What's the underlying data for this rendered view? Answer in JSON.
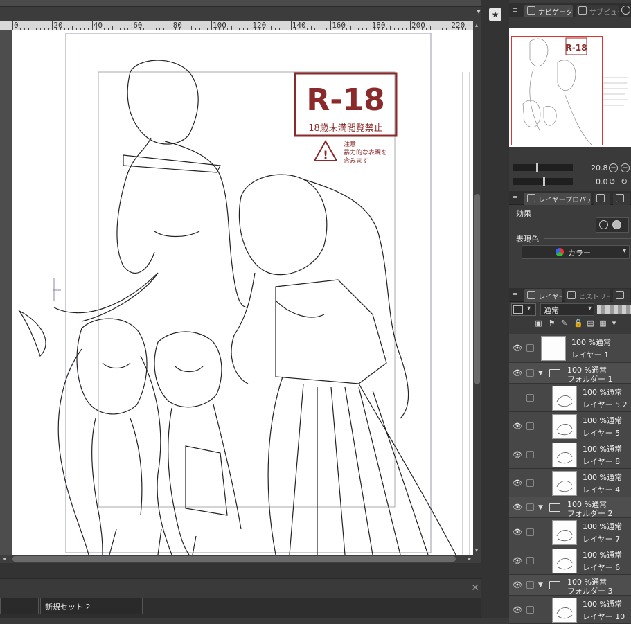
{
  "ruler": {
    "labels": [
      "0",
      "20",
      "40",
      "60",
      "80",
      "100",
      "120",
      "140",
      "160",
      "180",
      "200",
      "220"
    ]
  },
  "navigator": {
    "panel_menu": "≡",
    "tab_navigator": "ナビゲーター",
    "tab_subview": "サブビュー",
    "zoom_value": "20.8",
    "rotate_value": "0.0"
  },
  "layer_property": {
    "panel_menu": "≡",
    "tab_label": "レイヤープロパティ",
    "effect_label": "効果",
    "expression_label": "表現色",
    "expression_value": "カラー"
  },
  "layer_panel": {
    "panel_menu": "≡",
    "tab_layer": "レイヤー",
    "tab_history": "ヒストリー",
    "blend_mode": "通常"
  },
  "layers": [
    {
      "type": "layer",
      "mode": "100 %通常",
      "name": "レイヤー 1",
      "visible": true
    },
    {
      "type": "folder",
      "mode": "100 %通常",
      "name": "フォルダー 1",
      "visible": true
    },
    {
      "type": "layer",
      "mode": "100 %通常",
      "name": "レイヤー 5 2",
      "visible": false
    },
    {
      "type": "layer",
      "mode": "100 %通常",
      "name": "レイヤー 5",
      "visible": true
    },
    {
      "type": "layer",
      "mode": "100 %通常",
      "name": "レイヤー 8",
      "visible": true
    },
    {
      "type": "layer",
      "mode": "100 %通常",
      "name": "レイヤー 4",
      "visible": true
    },
    {
      "type": "folder",
      "mode": "100 %通常",
      "name": "フォルダー 2",
      "visible": true
    },
    {
      "type": "layer",
      "mode": "100 %通常",
      "name": "レイヤー 7",
      "visible": true
    },
    {
      "type": "layer",
      "mode": "100 %通常",
      "name": "レイヤー 6",
      "visible": true
    },
    {
      "type": "folder",
      "mode": "100 %通常",
      "name": "フォルダー 3",
      "visible": true
    },
    {
      "type": "layer",
      "mode": "100 %通常",
      "name": "レイヤー 10",
      "visible": true
    }
  ],
  "artwork": {
    "rating_big": "R-18",
    "rating_sub": "18歳未満閲覧禁止",
    "warning_line1": "注意",
    "warning_line2": "暴力的な表現を",
    "warning_line3": "含みます"
  },
  "bottom": {
    "set_tab": "新規セット 2"
  },
  "colors": {
    "rating_red": "#8b2a2a",
    "nav_frame": "#dd3333"
  }
}
